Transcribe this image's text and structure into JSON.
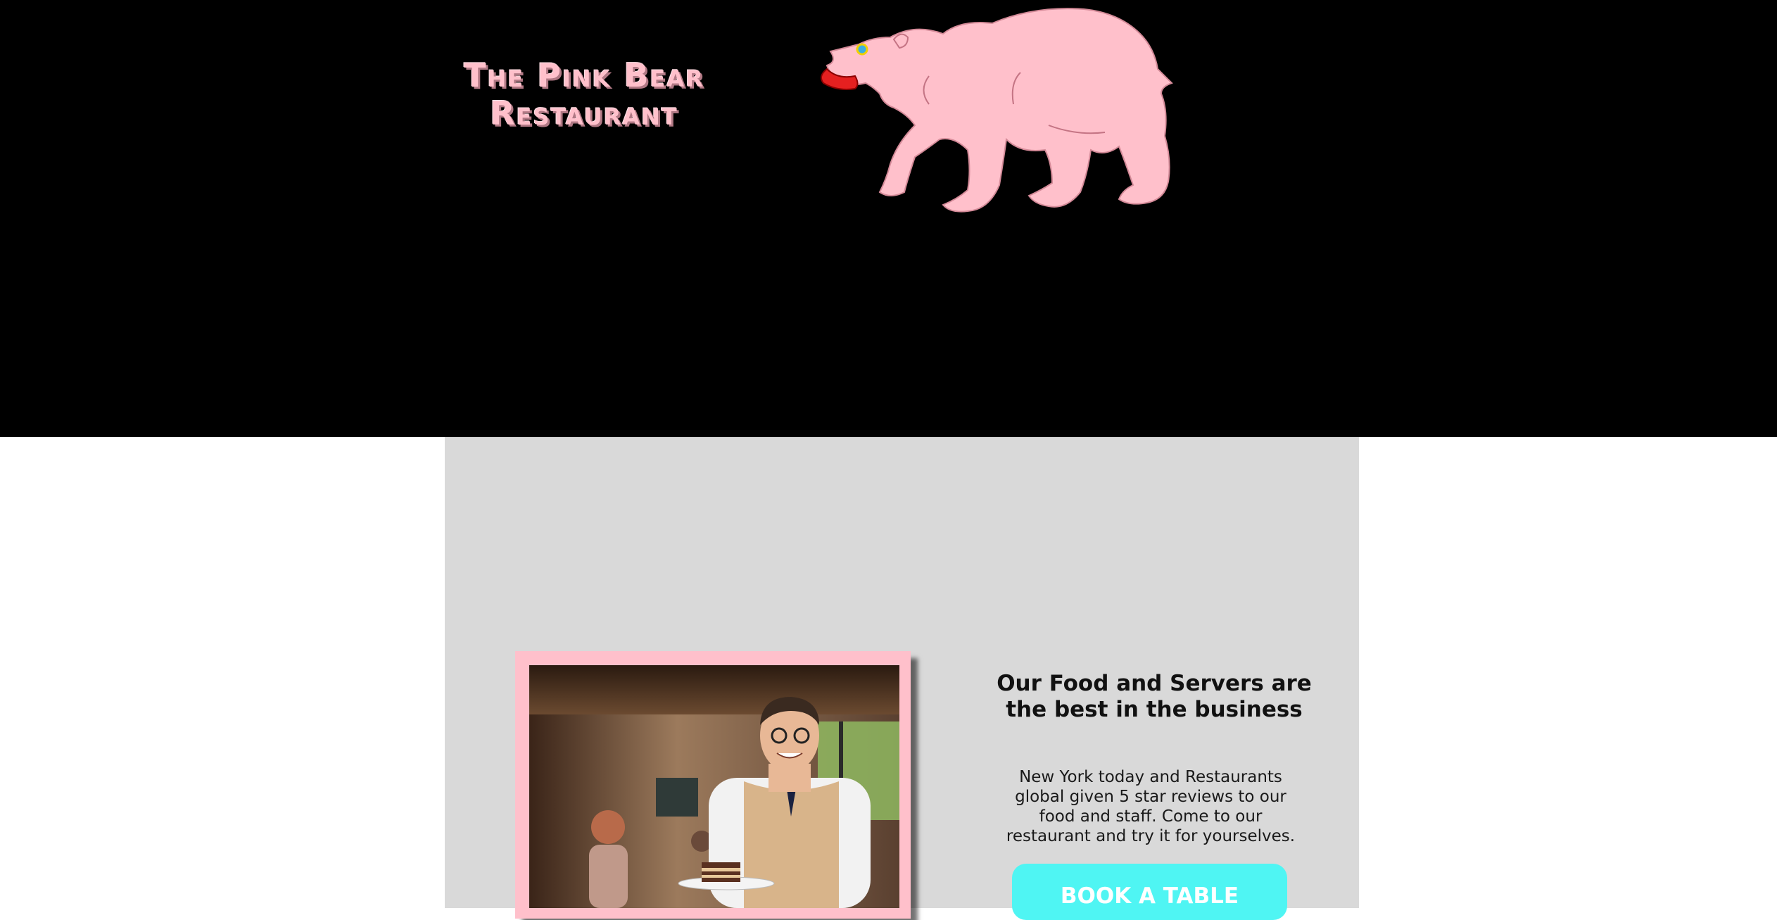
{
  "header": {
    "brand_line1": "The Pink Bear",
    "brand_line2": "Restaurant",
    "logo_icon": "pink-bear-illustration",
    "background_color": "#000000",
    "brand_color": "#ffc0cb"
  },
  "feature": {
    "headline": "Our Food and Servers are the best in the business",
    "body": "New York today and Restaurants global given 5 star reviews to our food and staff. Come to our restaurant and try it for yourselves.",
    "button_label": "BOOK A TABLE",
    "button_color": "#4ff5f3",
    "panel_color": "#d9d9d9",
    "photo_frame_color": "#ffc0cb"
  }
}
